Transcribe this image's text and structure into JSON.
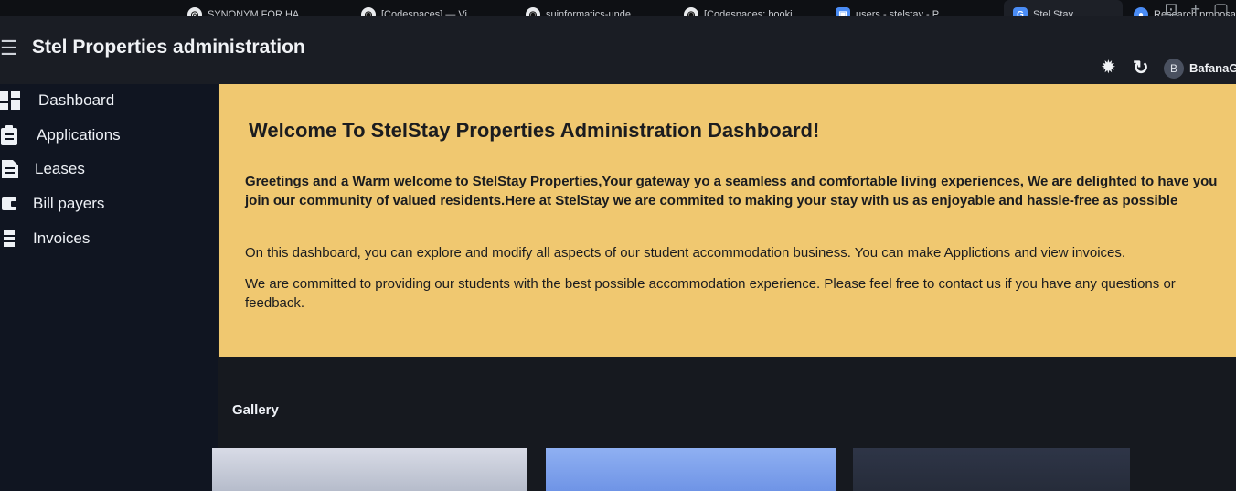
{
  "browser": {
    "tabs": [
      {
        "label": "SYNONYM FOR HA...",
        "icon": "globe-icon"
      },
      {
        "label": "[Codespaces] — Vi...",
        "icon": "github-icon"
      },
      {
        "label": "suinformatics-unde...",
        "icon": "github-icon"
      },
      {
        "label": "[Codespaces: booki...",
        "icon": "github-icon"
      },
      {
        "label": "users - stelstay - P...",
        "icon": "database-icon"
      },
      {
        "label": "Stel Stay",
        "icon": "app-icon",
        "favicon": "G"
      },
      {
        "label": "Research proposal...",
        "icon": "chrome-icon"
      }
    ]
  },
  "app": {
    "title": "Stel Properties administration",
    "user": {
      "initial": "B",
      "name": "BafanaG"
    }
  },
  "sidebar": {
    "items": [
      {
        "label": "Dashboard",
        "icon": "dashboard-icon"
      },
      {
        "label": "Applications",
        "icon": "clipboard-icon"
      },
      {
        "label": "Leases",
        "icon": "document-icon"
      },
      {
        "label": "Bill payers",
        "icon": "wallet-icon"
      },
      {
        "label": "Invoices",
        "icon": "list-icon"
      }
    ]
  },
  "welcome": {
    "heading": "Welcome To StelStay Properties Administration Dashboard!",
    "greeting": "Greetings and a Warm welcome to StelStay Properties,Your gateway yo a seamless and comfortable living experiences, We are delighted to have you join our community of valued residents.Here at StelStay we are commited to making your stay with us as enjoyable and hassle-free as possible",
    "explore": "On this dashboard, you can explore and modify all aspects of our student accommodation business. You can make Applictions and view invoices.",
    "commitment": "We are committed to providing our students with the best possible accommodation experience. Please feel free to contact us if you have any questions or feedback."
  },
  "gallery": {
    "title": "Gallery"
  },
  "colors": {
    "banner": "#f0c870",
    "sidebar": "#101521",
    "appbar": "#1a1d24"
  }
}
